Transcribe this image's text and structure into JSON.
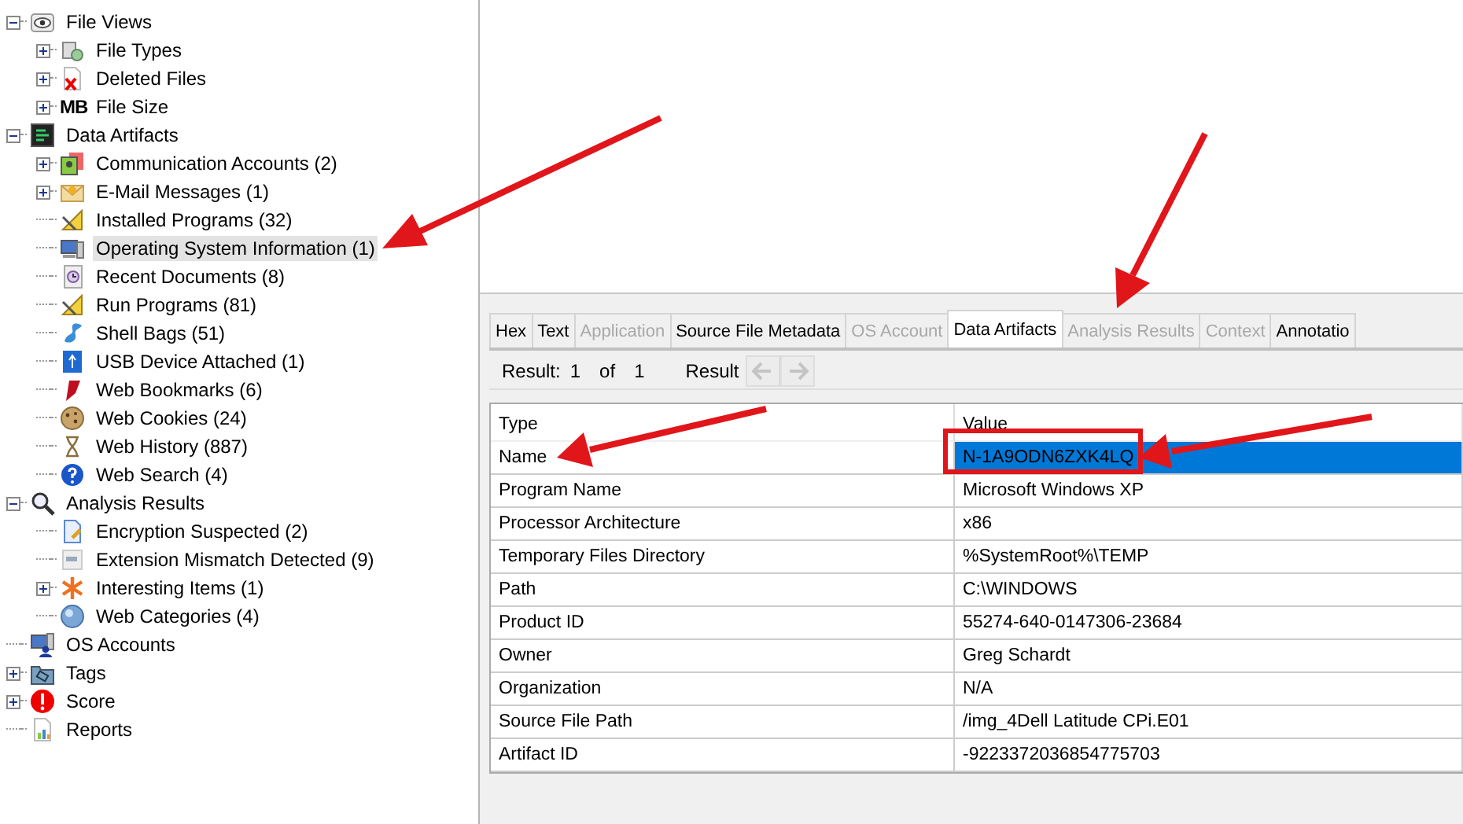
{
  "tree": [
    {
      "label": "File Views",
      "expanded": true,
      "selected": false,
      "children": [
        {
          "label": "File Types",
          "expanded": false,
          "selected": false
        },
        {
          "label": "Deleted Files",
          "expanded": false,
          "selected": false
        },
        {
          "label": "File Size",
          "icon_text": "MB",
          "expanded": false,
          "selected": false
        }
      ]
    },
    {
      "label": "Data Artifacts",
      "expanded": true,
      "selected": false,
      "children": [
        {
          "label": "Communication Accounts (2)",
          "expanded": false,
          "selected": false
        },
        {
          "label": "E-Mail Messages (1)",
          "expanded": false,
          "selected": false
        },
        {
          "label": "Installed Programs (32)",
          "selected": false
        },
        {
          "label": "Operating System Information (1)",
          "selected": true
        },
        {
          "label": "Recent Documents (8)",
          "selected": false
        },
        {
          "label": "Run Programs (81)",
          "selected": false
        },
        {
          "label": "Shell Bags (51)",
          "selected": false
        },
        {
          "label": "USB Device Attached (1)",
          "selected": false
        },
        {
          "label": "Web Bookmarks (6)",
          "selected": false
        },
        {
          "label": "Web Cookies (24)",
          "selected": false
        },
        {
          "label": "Web History (887)",
          "selected": false
        },
        {
          "label": "Web Search (4)",
          "selected": false
        }
      ]
    },
    {
      "label": "Analysis Results",
      "expanded": true,
      "selected": false,
      "children": [
        {
          "label": "Encryption Suspected (2)",
          "selected": false
        },
        {
          "label": "Extension Mismatch Detected (9)",
          "selected": false
        },
        {
          "label": "Interesting Items (1)",
          "expanded": false,
          "selected": false
        },
        {
          "label": "Web Categories (4)",
          "selected": false
        }
      ]
    },
    {
      "label": "OS Accounts",
      "selected": false
    },
    {
      "label": "Tags",
      "expanded": false,
      "selected": false
    },
    {
      "label": "Score",
      "expanded": false,
      "selected": false
    },
    {
      "label": "Reports",
      "selected": false
    }
  ],
  "tabs": [
    {
      "label": "Hex",
      "selected": false,
      "disabled": false
    },
    {
      "label": "Text",
      "selected": false,
      "disabled": false
    },
    {
      "label": "Application",
      "selected": false,
      "disabled": true
    },
    {
      "label": "Source File Metadata",
      "selected": false,
      "disabled": false
    },
    {
      "label": "OS Account",
      "selected": false,
      "disabled": true
    },
    {
      "label": "Data Artifacts",
      "selected": true,
      "disabled": false
    },
    {
      "label": "Analysis Results",
      "selected": false,
      "disabled": true
    },
    {
      "label": "Context",
      "selected": false,
      "disabled": true
    },
    {
      "label": "Annotatio",
      "selected": false,
      "disabled": false
    }
  ],
  "result_bar": {
    "label": "Result:",
    "current": "1",
    "of": "of",
    "total": "1",
    "suffix": "Result",
    "back_disabled": true,
    "forward_disabled": true
  },
  "table": {
    "columns": [
      "Type",
      "Value"
    ],
    "rows": [
      {
        "cells": [
          "Name",
          "N-1A9ODN6ZXK4LQ"
        ],
        "selected": true
      },
      {
        "cells": [
          "Program Name",
          "Microsoft Windows XP"
        ],
        "selected": false
      },
      {
        "cells": [
          "Processor Architecture",
          "x86"
        ],
        "selected": false
      },
      {
        "cells": [
          "Temporary Files Directory",
          "%SystemRoot%\\TEMP"
        ],
        "selected": false
      },
      {
        "cells": [
          "Path",
          "C:\\WINDOWS"
        ],
        "selected": false
      },
      {
        "cells": [
          "Product ID",
          "55274-640-0147306-23684"
        ],
        "selected": false
      },
      {
        "cells": [
          "Owner",
          "Greg Schardt"
        ],
        "selected": false
      },
      {
        "cells": [
          "Organization",
          "N/A"
        ],
        "selected": false
      },
      {
        "cells": [
          "Source File Path",
          "/img_4Dell Latitude CPi.E01"
        ],
        "selected": false
      },
      {
        "cells": [
          "Artifact ID",
          "-9223372036854775703"
        ],
        "selected": false
      }
    ]
  }
}
